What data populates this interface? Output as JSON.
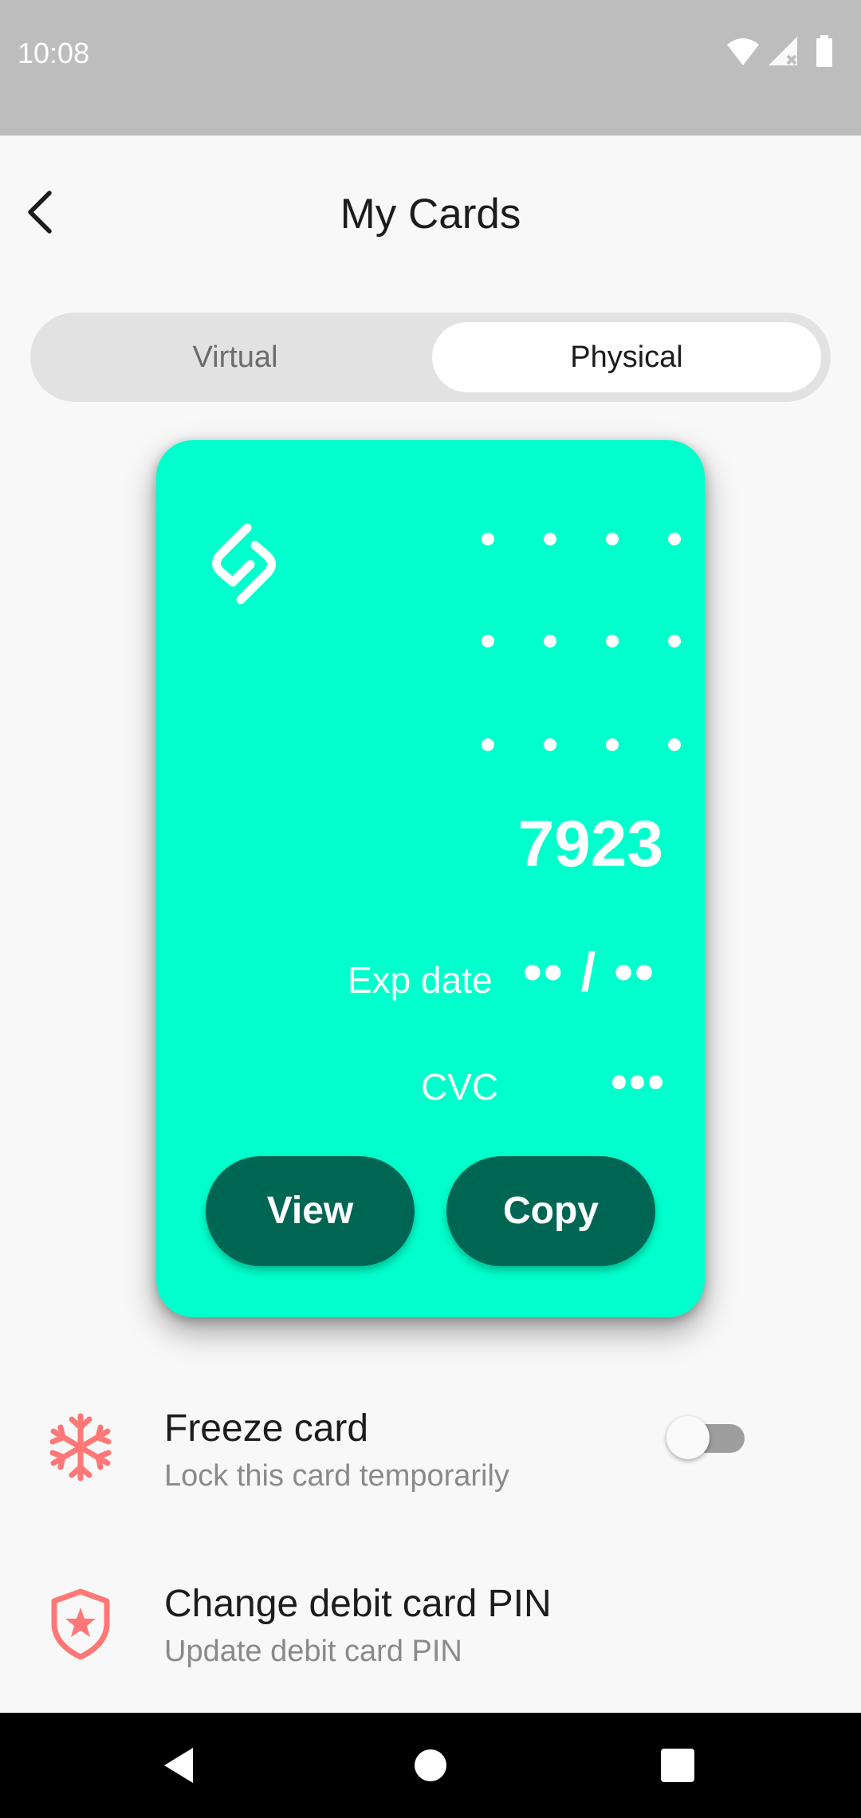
{
  "status_bar": {
    "time": "10:08",
    "icons": [
      "wifi-icon",
      "cell-signal-icon",
      "battery-icon"
    ]
  },
  "header": {
    "title": "My Cards",
    "back_icon": "back-arrow-icon"
  },
  "tabs": [
    {
      "label": "Virtual",
      "selected": false
    },
    {
      "label": "Physical",
      "selected": true
    }
  ],
  "card": {
    "background_color": "#00ffcc",
    "masked_group": "• • • •",
    "last4": "7923",
    "exp_label": "Exp date",
    "exp_value": "•• / ••",
    "cvc_label": "CVC",
    "cvc_value": "•••",
    "view_label": "View",
    "copy_label": "Copy",
    "button_color": "#006654"
  },
  "settings": [
    {
      "title": "Freeze card",
      "subtitle": "Lock this card temporarily",
      "icon": "snowflake-icon",
      "toggle_on": false
    },
    {
      "title": "Change debit card PIN",
      "subtitle": "Update debit card PIN",
      "icon": "shield-star-icon"
    }
  ],
  "accent_color": "#ff7777",
  "nav_bar": {
    "buttons": [
      "nav-back-icon",
      "nav-home-icon",
      "nav-recents-icon"
    ]
  }
}
